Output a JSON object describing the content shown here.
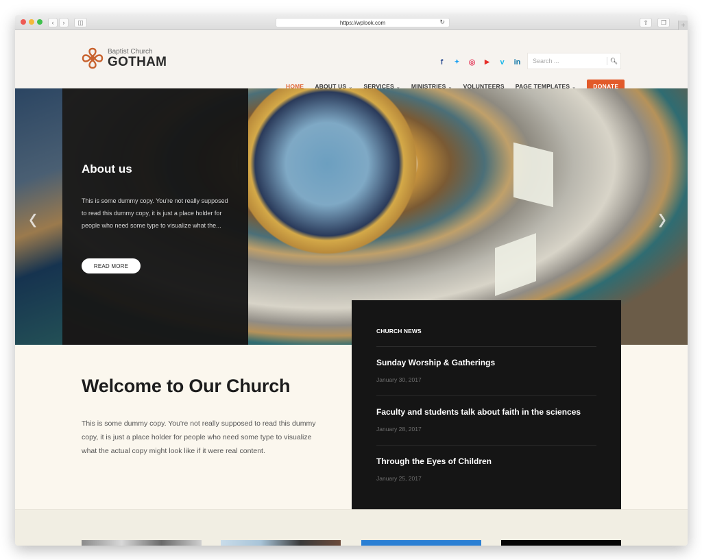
{
  "browser": {
    "url": "https://wplook.com",
    "back_icon": "chevron-left-icon",
    "forward_icon": "chevron-right-icon",
    "sidebar_icon": "sidebar-icon",
    "reload_icon": "reload-icon",
    "share_icon": "share-icon",
    "tabs_icon": "tabs-icon",
    "new_tab_icon": "plus-icon"
  },
  "header": {
    "logo_subtitle": "Baptist Church",
    "logo_title": "GOTHAM",
    "logo_color": "#c8622e",
    "social": [
      {
        "name": "facebook",
        "glyph": "f",
        "color": "#3b5998"
      },
      {
        "name": "twitter",
        "glyph": "🐦",
        "color": "#1da1f2"
      },
      {
        "name": "instagram",
        "glyph": "◎",
        "color": "#e4405f"
      },
      {
        "name": "youtube",
        "glyph": "▶",
        "color": "#e52d27"
      },
      {
        "name": "vimeo",
        "glyph": "v",
        "color": "#1ab7ea"
      },
      {
        "name": "linkedin",
        "glyph": "in",
        "color": "#0e76a8"
      }
    ],
    "search_placeholder": "Search ...",
    "nav": [
      {
        "label": "HOME",
        "active": true,
        "dropdown": false
      },
      {
        "label": "ABOUT US",
        "active": false,
        "dropdown": true
      },
      {
        "label": "SERVICES",
        "active": false,
        "dropdown": true
      },
      {
        "label": "MINISTRIES",
        "active": false,
        "dropdown": true
      },
      {
        "label": "VOLUNTEERS",
        "active": false,
        "dropdown": false
      },
      {
        "label": "PAGE TEMPLATES",
        "active": false,
        "dropdown": true
      }
    ],
    "donate_label": "DONATE",
    "accent_color": "#e25a2a"
  },
  "hero": {
    "title": "About us",
    "text": "This is some dummy copy. You're not really supposed to read this dummy copy, it is just a place holder for people who need some type to visualize what the...",
    "button_label": "READ MORE",
    "prev_glyph": "‹",
    "next_glyph": "›"
  },
  "welcome": {
    "title": "Welcome to Our Church",
    "text": "This is some dummy copy. You're not really supposed to read this dummy copy, it is just a place holder for people who need some type to visualize what the actual copy might look like if it were real content."
  },
  "news": {
    "title": "CHURCH NEWS",
    "items": [
      {
        "title": "Sunday Worship & Gatherings",
        "date": "January 30, 2017"
      },
      {
        "title": "Faculty and students talk about faith in the sciences",
        "date": "January 28, 2017"
      },
      {
        "title": "Through the Eyes of Children",
        "date": "January 25, 2017"
      }
    ]
  }
}
